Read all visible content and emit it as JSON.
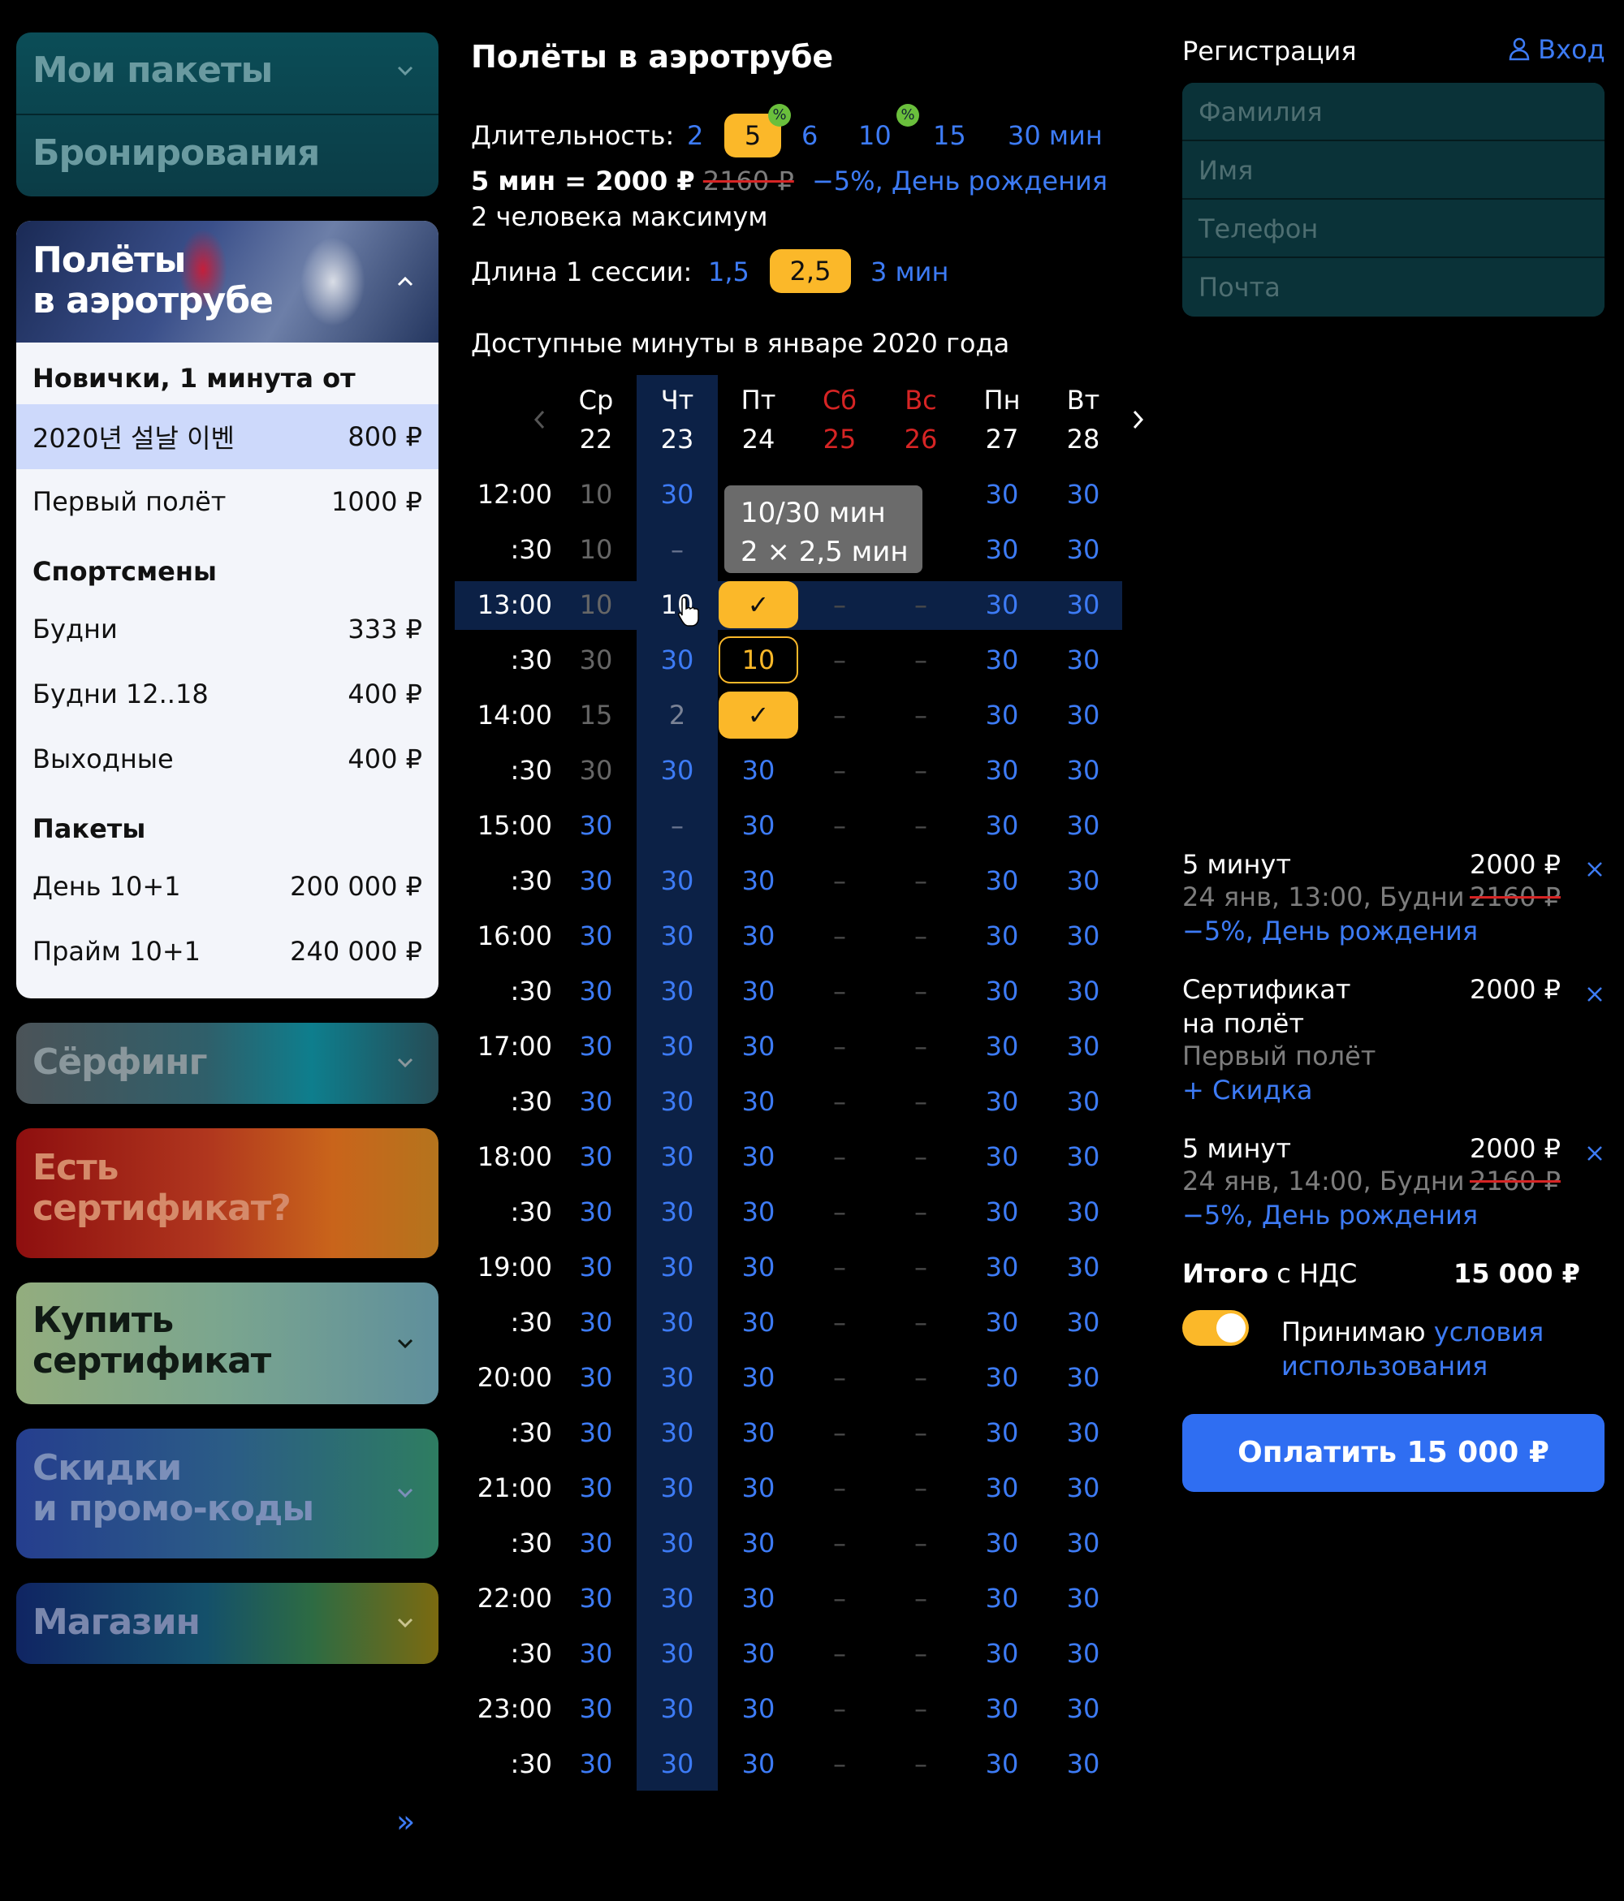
{
  "sidebar": {
    "my_packages": "Мои пакеты",
    "bookings": "Бронирования",
    "tunnel_title_1": "Полёты",
    "tunnel_title_2": "в аэротрубе",
    "beginners_header": "Новички, 1 минута от",
    "beginners": [
      {
        "label": "2020년 설날 이벤",
        "price": "800 ₽"
      },
      {
        "label": "Первый полёт",
        "price": "1000 ₽"
      }
    ],
    "athletes_header": "Спортсмены",
    "athletes": [
      {
        "label": "Будни",
        "price": "333 ₽"
      },
      {
        "label": "Будни 12..18",
        "price": "400 ₽"
      },
      {
        "label": "Выходные",
        "price": "400 ₽"
      }
    ],
    "packages_header": "Пакеты",
    "packages": [
      {
        "label": "День 10+1",
        "price": "200 000 ₽"
      },
      {
        "label": "Прайм 10+1",
        "price": "240 000 ₽"
      }
    ],
    "surfing": "Сёрфинг",
    "have_cert_1": "Есть",
    "have_cert_2": "сертификат?",
    "buy_cert_1": "Купить",
    "buy_cert_2": "сертификат",
    "discounts_1": "Скидки",
    "discounts_2": "и промо-коды",
    "shop": "Магазин",
    "expand": "»"
  },
  "main": {
    "title": "Полёты в аэротрубе",
    "duration_label": "Длительность:",
    "durations": [
      "2",
      "5",
      "6",
      "10",
      "15",
      "30 мин"
    ],
    "discount_badge": "%",
    "price_line_bold": "5 мин = 2000 ₽",
    "price_old": "2160 ₽",
    "price_discount": "−5%, День рождения",
    "max_people": "2 человека максимум",
    "session_label": "Длина 1 сессии:",
    "sessions": [
      "1,5",
      "2,5",
      "3 мин"
    ],
    "available": "Доступные минуты в январе 2020 года",
    "days": [
      {
        "dow": "Ср",
        "num": "22"
      },
      {
        "dow": "Чт",
        "num": "23"
      },
      {
        "dow": "Пт",
        "num": "24"
      },
      {
        "dow": "Сб",
        "num": "25"
      },
      {
        "dow": "Вс",
        "num": "26"
      },
      {
        "dow": "Пн",
        "num": "27"
      },
      {
        "dow": "Вт",
        "num": "28"
      }
    ],
    "times": [
      "12:00",
      ":30",
      "13:00",
      ":30",
      "14:00",
      ":30",
      "15:00",
      ":30",
      "16:00",
      ":30",
      "17:00",
      ":30",
      "18:00",
      ":30",
      "19:00",
      ":30",
      "20:00",
      ":30",
      "21:00",
      ":30",
      "22:00",
      ":30",
      "23:00",
      ":30"
    ],
    "tooltip_1": "10/30 мин",
    "tooltip_2": "2 × 2,5 мин",
    "check": "✓",
    "dash": "–",
    "grid": [
      [
        "10",
        "30",
        "",
        "",
        "",
        "30",
        "30"
      ],
      [
        "10",
        "–",
        "",
        "",
        "",
        "30",
        "30"
      ],
      [
        "10",
        "10",
        "✓",
        "–",
        "–",
        "30",
        "30"
      ],
      [
        "30",
        "30",
        "10",
        "–",
        "–",
        "30",
        "30"
      ],
      [
        "15",
        "2",
        "✓",
        "–",
        "–",
        "30",
        "30"
      ],
      [
        "30",
        "30",
        "30",
        "–",
        "–",
        "30",
        "30"
      ],
      [
        "30",
        "–",
        "30",
        "–",
        "–",
        "30",
        "30"
      ],
      [
        "30",
        "30",
        "30",
        "–",
        "–",
        "30",
        "30"
      ],
      [
        "30",
        "30",
        "30",
        "–",
        "–",
        "30",
        "30"
      ],
      [
        "30",
        "30",
        "30",
        "–",
        "–",
        "30",
        "30"
      ],
      [
        "30",
        "30",
        "30",
        "–",
        "–",
        "30",
        "30"
      ],
      [
        "30",
        "30",
        "30",
        "–",
        "–",
        "30",
        "30"
      ],
      [
        "30",
        "30",
        "30",
        "–",
        "–",
        "30",
        "30"
      ],
      [
        "30",
        "30",
        "30",
        "–",
        "–",
        "30",
        "30"
      ],
      [
        "30",
        "30",
        "30",
        "–",
        "–",
        "30",
        "30"
      ],
      [
        "30",
        "30",
        "30",
        "–",
        "–",
        "30",
        "30"
      ],
      [
        "30",
        "30",
        "30",
        "–",
        "–",
        "30",
        "30"
      ],
      [
        "30",
        "30",
        "30",
        "–",
        "–",
        "30",
        "30"
      ],
      [
        "30",
        "30",
        "30",
        "–",
        "–",
        "30",
        "30"
      ],
      [
        "30",
        "30",
        "30",
        "–",
        "–",
        "30",
        "30"
      ],
      [
        "30",
        "30",
        "30",
        "–",
        "–",
        "30",
        "30"
      ],
      [
        "30",
        "30",
        "30",
        "–",
        "–",
        "30",
        "30"
      ],
      [
        "30",
        "30",
        "30",
        "–",
        "–",
        "30",
        "30"
      ],
      [
        "30",
        "30",
        "30",
        "–",
        "–",
        "30",
        "30"
      ]
    ]
  },
  "right": {
    "register": "Регистрация",
    "login": "Вход",
    "placeholders": {
      "surname": "Фамилия",
      "name": "Имя",
      "phone": "Телефон",
      "email": "Почта"
    },
    "cart": [
      {
        "title": "5 минут",
        "price": "2000 ₽",
        "sub": "24 янв, 13:00, Будни",
        "old": "2160 ₽",
        "disc": "−5%, День рождения"
      },
      {
        "title": "Сертификат",
        "title2": "на полёт",
        "price": "2000 ₽",
        "sub": "Первый полёт",
        "disc": "+ Скидка"
      },
      {
        "title": "5 минут",
        "price": "2000 ₽",
        "sub": "24 янв, 14:00, Будни",
        "old": "2160 ₽",
        "disc": "−5%, День рождения"
      }
    ],
    "total_bold": "Итого",
    "total_rest": " с НДС",
    "total_value": "15 000 ₽",
    "accept": "Принимаю ",
    "terms_1": "условия",
    "terms_2": "использования",
    "pay": "Оплатить 15 000 ₽"
  },
  "colors": {
    "accent": "#fbb829",
    "link": "#3d7bf5",
    "selected_col": "#0c2146"
  }
}
